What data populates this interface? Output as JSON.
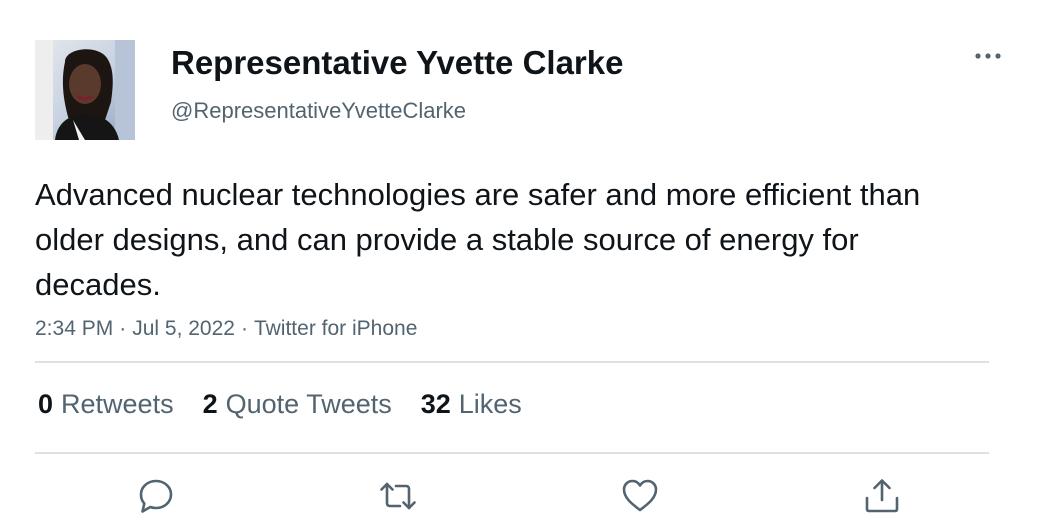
{
  "tweet": {
    "author": {
      "display_name": "Representative Yvette Clarke",
      "handle": "@RepresentativeYvetteClarke"
    },
    "text": "Advanced nuclear technologies are safer and more efficient than older designs, and can provide a stable source of energy for decades.",
    "time": "2:34 PM",
    "date": "Jul 5, 2022",
    "source": "Twitter for iPhone",
    "separator": "·"
  },
  "stats": [
    {
      "count": "0",
      "label": "Retweets"
    },
    {
      "count": "2",
      "label": "Quote Tweets"
    },
    {
      "count": "32",
      "label": "Likes"
    }
  ],
  "actions": [
    {
      "icon": "reply-icon"
    },
    {
      "icon": "retweet-icon"
    },
    {
      "icon": "like-icon"
    },
    {
      "icon": "share-icon"
    }
  ],
  "colors": {
    "text_primary": "#0f1419",
    "text_secondary": "#536471",
    "divider": "#dde1e5",
    "icon": "#536471"
  }
}
